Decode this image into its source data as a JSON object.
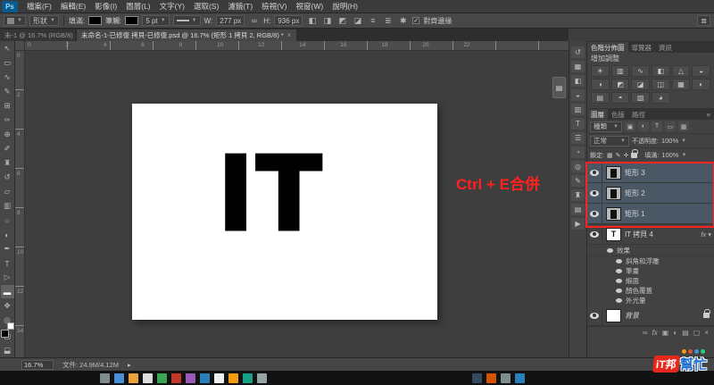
{
  "menubar": {
    "logo": "Ps",
    "items": [
      "檔案(F)",
      "編輯(E)",
      "影像(I)",
      "圖層(L)",
      "文字(Y)",
      "選取(S)",
      "濾鏡(T)",
      "檢視(V)",
      "視窗(W)",
      "說明(H)"
    ]
  },
  "options_bar": {
    "tool_mode": "形狀",
    "fill_label": "填滿:",
    "stroke_label": "筆觸:",
    "stroke_width": "5 pt",
    "w_label": "W:",
    "w_value": "277 px",
    "link_glyph": "∞",
    "h_label": "H:",
    "h_value": "936 px",
    "combine_icons": [
      {
        "name": "combine-shapes",
        "glyph": "◧"
      },
      {
        "name": "subtract-shape",
        "glyph": "◨"
      },
      {
        "name": "intersect-shape",
        "glyph": "◩"
      },
      {
        "name": "exclude-shape",
        "glyph": "◪"
      }
    ],
    "align_icon": "≡",
    "arrange_icon": "≣",
    "gear_icon": "✱",
    "checkmark": "✓",
    "align_edges": "對齊邊緣",
    "workspace_glyph": "≣"
  },
  "doc_tabs": {
    "inactive": "未-1 @ 16.7% (RGB/8)",
    "active": "未命名-1-已修復 拷貝-已修復.psd @ 16.7% (矩形 1 拷貝 2, RGB/8) *",
    "close": "×"
  },
  "tools": {
    "items": [
      {
        "name": "move",
        "glyph": "↖"
      },
      {
        "name": "marquee",
        "glyph": "▭"
      },
      {
        "name": "lasso",
        "glyph": "∿"
      },
      {
        "name": "quick-selection",
        "glyph": "✎"
      },
      {
        "name": "crop",
        "glyph": "⊞"
      },
      {
        "name": "eyedropper",
        "glyph": "✑"
      },
      {
        "name": "spot-healing",
        "glyph": "⊕"
      },
      {
        "name": "brush",
        "glyph": "✐"
      },
      {
        "name": "clone-stamp",
        "glyph": "♜"
      },
      {
        "name": "history-brush",
        "glyph": "↺"
      },
      {
        "name": "eraser",
        "glyph": "▱"
      },
      {
        "name": "gradient",
        "glyph": "▥"
      },
      {
        "name": "blur",
        "glyph": "○"
      },
      {
        "name": "dodge",
        "glyph": "◐"
      },
      {
        "name": "pen",
        "glyph": "✒"
      },
      {
        "name": "type",
        "glyph": "T"
      },
      {
        "name": "path-selection",
        "glyph": "▷"
      },
      {
        "name": "rectangle-shape",
        "glyph": "▬"
      },
      {
        "name": "hand",
        "glyph": "✥"
      },
      {
        "name": "zoom",
        "glyph": "◎"
      }
    ],
    "screen_mode_glyph": "⬓",
    "quick_mask_glyph": "▢"
  },
  "rulers": {
    "h": "0 2 4 6 8 10 12 14 16 18 20 22",
    "v": [
      "0",
      "2",
      "4",
      "6",
      "8",
      "10",
      "12",
      "14"
    ]
  },
  "canvas": {
    "text": "IT",
    "float_icon": "▤"
  },
  "annotation": {
    "text": "Ctrl + E合併",
    "color": "#ff2020"
  },
  "collapsed_panels": {
    "icons": [
      {
        "name": "history",
        "glyph": "↺"
      },
      {
        "name": "swatches",
        "glyph": "▦"
      },
      {
        "name": "styles",
        "glyph": "◧"
      },
      {
        "name": "color",
        "glyph": "◒"
      },
      {
        "name": "properties",
        "glyph": "▥"
      },
      {
        "name": "character",
        "glyph": "T"
      },
      {
        "name": "paragraph",
        "glyph": "☰"
      },
      {
        "name": "info",
        "glyph": "◔"
      },
      {
        "name": "navigator",
        "glyph": "◎"
      },
      {
        "name": "brush-presets",
        "glyph": "✎"
      },
      {
        "name": "clone-source",
        "glyph": "♜"
      },
      {
        "name": "timeline",
        "glyph": "▤"
      },
      {
        "name": "actions",
        "glyph": "▶"
      }
    ]
  },
  "adjustments_panel": {
    "tabs": [
      "色階分佈圖",
      "導覽器",
      "資訊"
    ],
    "header": "增加調整",
    "icons": [
      {
        "name": "brightness-contrast",
        "glyph": "☀"
      },
      {
        "name": "levels",
        "glyph": "▥"
      },
      {
        "name": "curves",
        "glyph": "∿"
      },
      {
        "name": "exposure",
        "glyph": "◧"
      },
      {
        "name": "vibrance",
        "glyph": "△"
      },
      {
        "name": "hue-saturation",
        "glyph": "◒"
      },
      {
        "name": "color-balance",
        "glyph": "◑"
      },
      {
        "name": "black-white",
        "glyph": "◩"
      },
      {
        "name": "photo-filter",
        "glyph": "◪"
      },
      {
        "name": "channel-mixer",
        "glyph": "◫"
      },
      {
        "name": "color-lookup",
        "glyph": "▦"
      },
      {
        "name": "invert",
        "glyph": "◐"
      },
      {
        "name": "posterize",
        "glyph": "▤"
      },
      {
        "name": "threshold",
        "glyph": "◓"
      },
      {
        "name": "gradient-map",
        "glyph": "▧"
      },
      {
        "name": "selective-color",
        "glyph": "◕"
      }
    ]
  },
  "layers_panel": {
    "tabs": [
      "圖層",
      "色版",
      "路徑"
    ],
    "menu_glyph": "≡",
    "filter_label": "種類",
    "filter_icons": [
      {
        "name": "filter-pixel-layers",
        "glyph": "▣"
      },
      {
        "name": "filter-adjustment-layers",
        "glyph": "◐"
      },
      {
        "name": "filter-type-layers",
        "glyph": "T"
      },
      {
        "name": "filter-shape-layers",
        "glyph": "▭"
      },
      {
        "name": "filter-smart-objects",
        "glyph": "▦"
      }
    ],
    "blend_mode": "正常",
    "opacity_label": "不透明度:",
    "opacity_value": "100%",
    "lock_label": "鎖定:",
    "lock_icons": [
      {
        "name": "lock-transparency",
        "glyph": "▦"
      },
      {
        "name": "lock-pixels",
        "glyph": "✎"
      },
      {
        "name": "lock-position",
        "glyph": "✛"
      }
    ],
    "fill_label": "填滿:",
    "fill_value": "100%",
    "layers": [
      {
        "name": "矩形 3"
      },
      {
        "name": "矩形 2"
      },
      {
        "name": "矩形 1"
      },
      {
        "name": "IT 拷貝 4"
      },
      {
        "name": "背景"
      }
    ],
    "fx_badge": "fx",
    "fx_arrow": "▾",
    "effects_header": "效果",
    "effects": [
      "斜角和浮雕",
      "筆畫",
      "緞面",
      "顏色覆蓋",
      "外光暈"
    ],
    "bottom_icons": [
      {
        "name": "link-layers",
        "glyph": "∞"
      },
      {
        "name": "layer-style",
        "glyph": "fx"
      },
      {
        "name": "add-layer-mask",
        "glyph": "▣"
      },
      {
        "name": "new-adjustment-layer",
        "glyph": "◐"
      },
      {
        "name": "new-group",
        "glyph": "▤"
      },
      {
        "name": "new-layer",
        "glyph": "▢"
      },
      {
        "name": "delete-layer",
        "glyph": "×"
      }
    ]
  },
  "status_bar": {
    "zoom": "16.7%",
    "doc_info": "文件: 24.9M/4.12M",
    "arrow": "▸"
  },
  "watermark": {
    "part1": "iT邦",
    "part2": "幫忙"
  }
}
